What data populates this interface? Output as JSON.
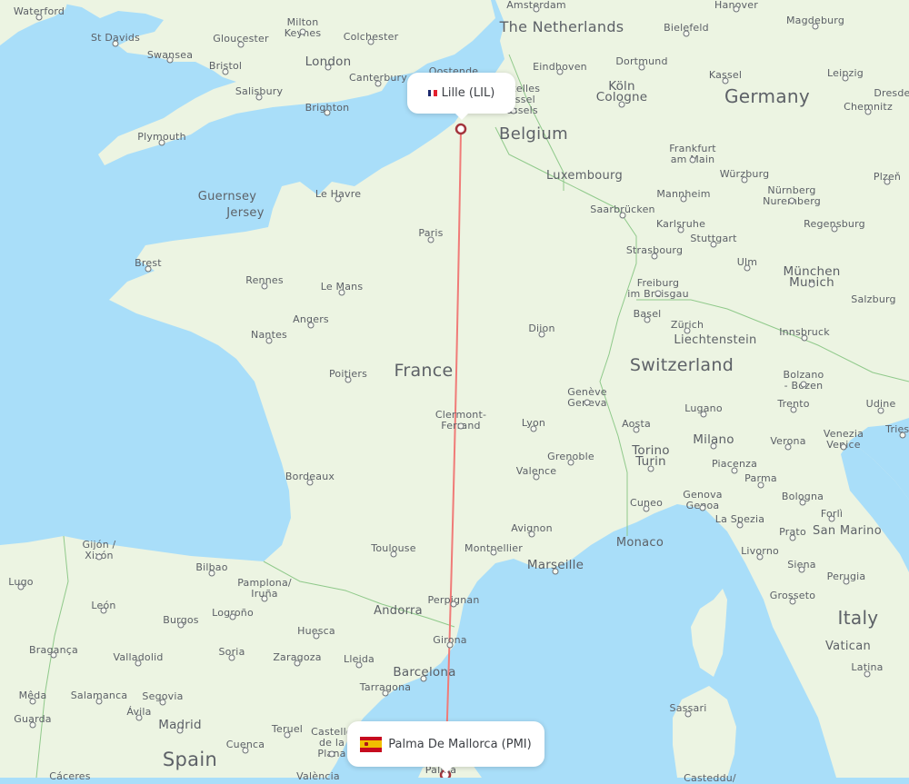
{
  "route": {
    "origin": {
      "city": "Lille",
      "code": "LIL",
      "label": "Lille (LIL)",
      "country_flag": "france-flag-icon"
    },
    "destination": {
      "city": "Palma De Mallorca",
      "code": "PMI",
      "label": "Palma De Mallorca (PMI)",
      "country_flag": "spain-flag-icon"
    },
    "line_color": "#f07b78",
    "marker_color": "#a3343c"
  },
  "colors": {
    "sea": "#a9def9",
    "land": "#ecf4e2",
    "border": "#8fc98a",
    "label": "#5b5f66",
    "flag_fr": [
      "#1d2a6e",
      "#ffffff",
      "#e3202f"
    ]
  },
  "countries": [
    "The Netherlands",
    "Belgium",
    "Germany",
    "France",
    "Switzerland",
    "Italy",
    "Spain",
    "Liechtenstein",
    "Andorra",
    "Monaco",
    "San Marino",
    "Vatican",
    "Luxembourg",
    "Guernsey",
    "Jersey"
  ],
  "cities": [
    "Waterford",
    "St Davids",
    "Swansea",
    "Gloucester",
    "Bristol",
    "Salisbury",
    "Plymouth",
    "Milton Keynes",
    "Colchester",
    "London",
    "Canterbury",
    "Brighton",
    "Oostende",
    "Amsterdam",
    "Eindhoven",
    "Bielefeld",
    "Hanover",
    "Magdeburg",
    "Dortmund",
    "Köln Cologne",
    "Kassel",
    "Leipzig",
    "Dresden",
    "Chemnitz",
    "Bruxelles Brussel Brussels",
    "Frankfurt am Main",
    "Würzburg",
    "Nürnberg Nuremberg",
    "Plzeň",
    "Mannheim",
    "Saarbrücken",
    "Karlsruhe",
    "Stuttgart",
    "Regensburg",
    "Strasbourg",
    "Ulm",
    "München Munich",
    "Freiburg im Breisgau",
    "Salzburg",
    "Le Havre",
    "Paris",
    "Brest",
    "Rennes",
    "Le Mans",
    "Angers",
    "Nantes",
    "Poitiers",
    "Dijon",
    "Basel",
    "Zürich",
    "Innsbruck",
    "Bolzano - Bozen",
    "Genève Geneva",
    "Lugano",
    "Trento",
    "Udine",
    "Aosta",
    "Milano",
    "Verona",
    "Venezia Venice",
    "Trieste",
    "Torino Turin",
    "Piacenza",
    "Parma",
    "Clermont-Ferrand",
    "Lyon",
    "Grenoble",
    "Valence",
    "Bordeaux",
    "Genova Genoa",
    "Bologna",
    "Cuneo",
    "Forlì",
    "La Spezia",
    "Prato",
    "Avignon",
    "Montpellier",
    "Marseille",
    "Livorno",
    "Siena",
    "Perugia",
    "Toulouse",
    "Grosseto",
    "Gijón / Xixón",
    "Bilbao",
    "Pamplona/ Iruña",
    "Lugo",
    "León",
    "Burgos",
    "Logroño",
    "Huesca",
    "Perpignan",
    "Girona",
    "Bragança",
    "Valladolid",
    "Soria",
    "Zaragoza",
    "Lleida",
    "Barcelona",
    "Tarragona",
    "Latina",
    "Mêda",
    "Salamanca",
    "Segovia",
    "Ávila",
    "Guarda",
    "Madrid",
    "Teruel",
    "Castelló de la Plana",
    "Cuenca",
    "Sassari",
    "Cáceres",
    "València",
    "Palma",
    "Casteddu/"
  ]
}
